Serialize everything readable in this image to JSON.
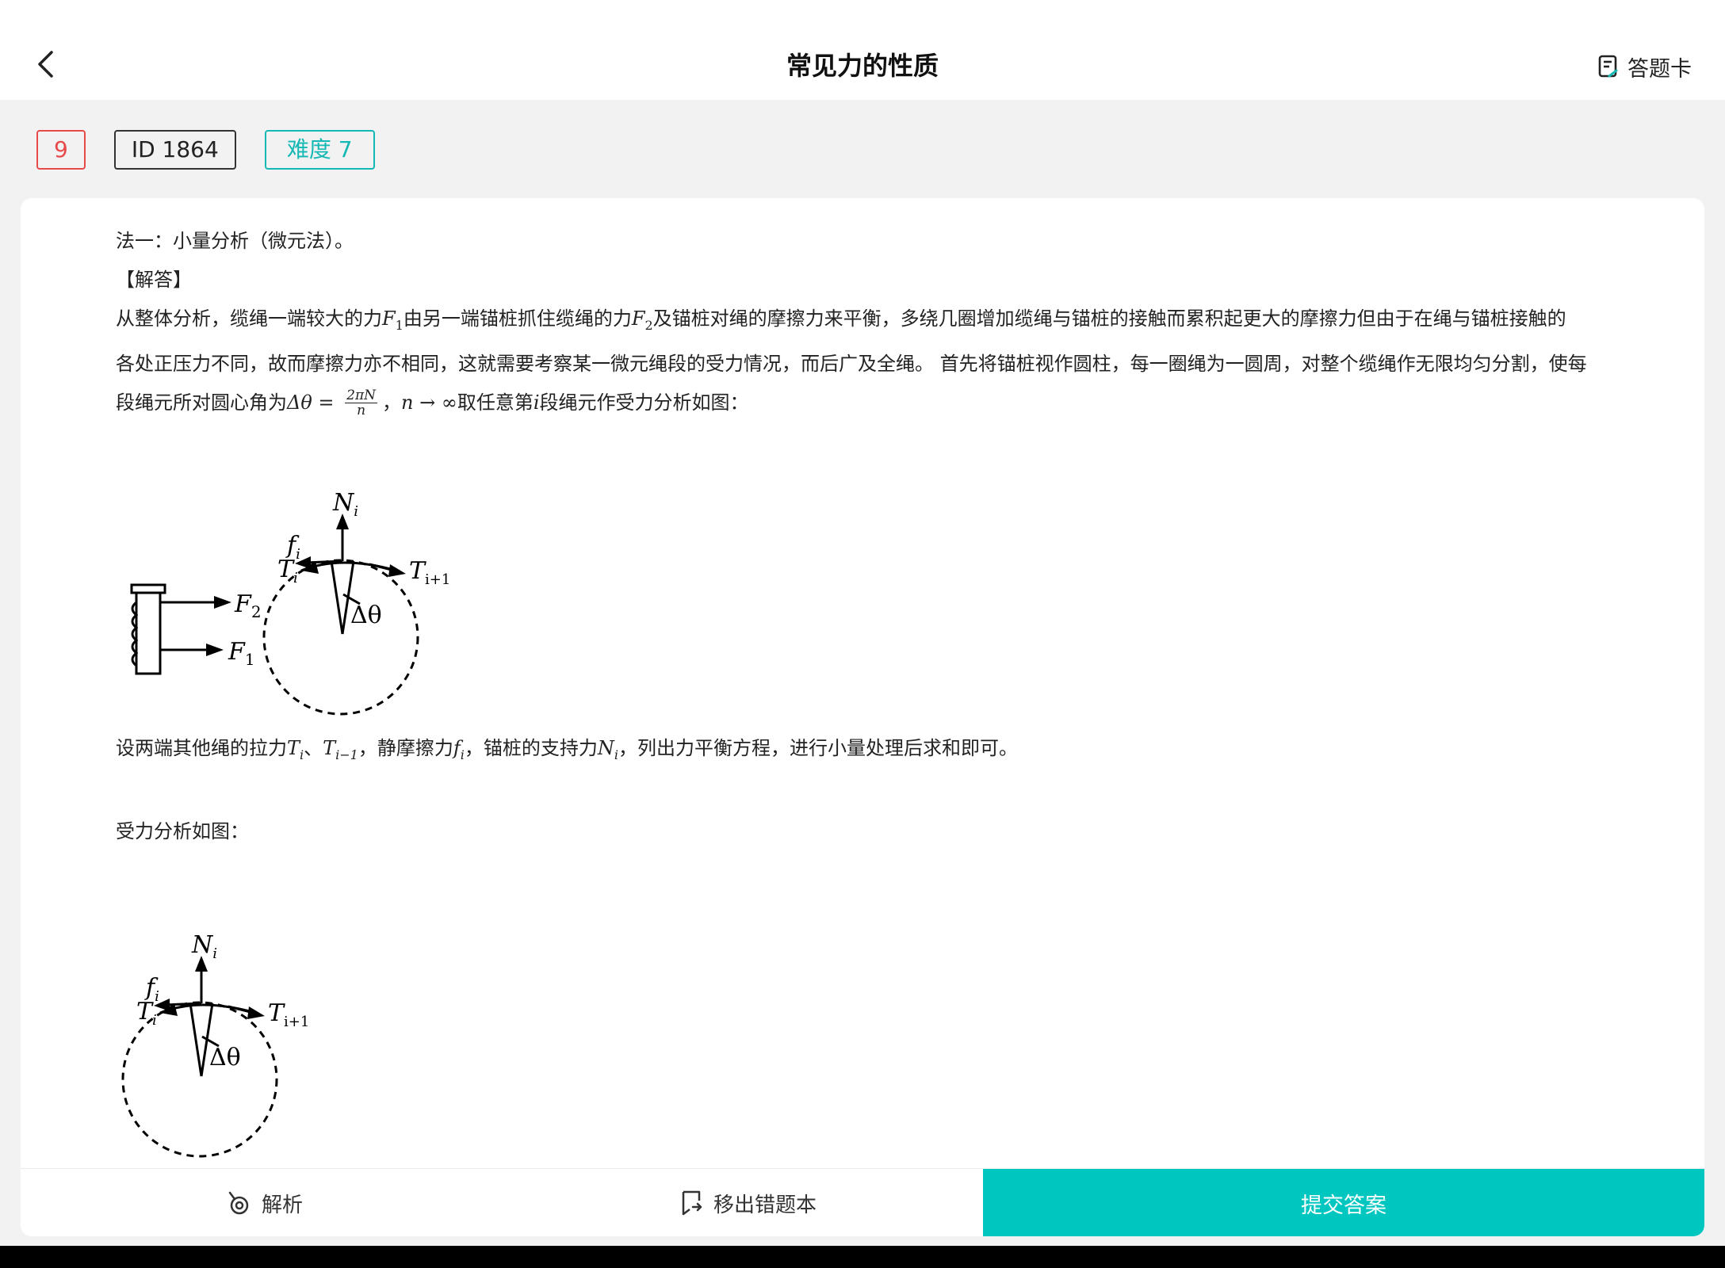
{
  "header": {
    "title": "常见力的性质",
    "answer_card_label": "答题卡"
  },
  "tags": {
    "number": "9",
    "id": "ID 1864",
    "difficulty": "难度 7"
  },
  "content": {
    "line1": "法一：小量分析（微元法）。",
    "line2": "【解答】",
    "p1_a": "从整体分析，缆绳一端较大的力",
    "p1_b": "由另一端锚桩抓住缆绳的力",
    "p1_c": "及锚桩对绳的摩擦力来平衡，多绕几圈增加缆绳与锚桩的接触而累积起更大的摩擦力但由于在绳与锚桩接触的",
    "p2": "各处正压力不同，故而摩擦力亦不相同，这就需要考察某一微元绳段的受力情况，而后广及全绳。 首先将锚桩视作圆柱，每一圈绳为一圆周，对整个缆绳作无限均匀分割，使每",
    "p3_a": "段绳元所对圆心角为",
    "p3_b": "，",
    "p3_c": "取任意第",
    "p3_d": "段绳元作受力分析如图：",
    "p4_a": "设两端其他绳的拉力",
    "p4_b": "、",
    "p4_c": "，静摩擦力",
    "p4_d": "，锚桩的支持力",
    "p4_e": "，列出力平衡方程，进行小量处理后求和即可。",
    "p5": "受力分析如图："
  },
  "math": {
    "F1": "F",
    "F1_sub": "1",
    "F2": "F",
    "F2_sub": "2",
    "delta_theta": "Δθ = ",
    "frac_num": "2πN",
    "frac_den": "n",
    "n_limit": "n → ∞",
    "i": "i",
    "Ti": "T",
    "Ti_sub": "i",
    "Ti1": "T",
    "Ti1_sub": "i−1",
    "fi": "f",
    "fi_sub": "i",
    "Ni": "N",
    "Ni_sub": "i"
  },
  "figure1": {
    "F2_label": "F",
    "F2_sub": "2",
    "F1_label": "F",
    "F1_sub": "1",
    "N_label": "N",
    "N_sub": "i",
    "f_label": "f",
    "f_sub": "i",
    "T_label": "T",
    "T_sub": "i",
    "T1_label": "T",
    "T1_sub": "i+1",
    "angle_label": "Δθ"
  },
  "figure2": {
    "N_label": "N",
    "N_sub": "i",
    "f_label": "f",
    "f_sub": "i",
    "T_label": "T",
    "T_sub": "i",
    "T1_label": "T",
    "T1_sub": "i+1",
    "angle_label": "Δθ"
  },
  "bottom_bar": {
    "analysis_label": "解析",
    "remove_label": "移出错题本",
    "submit_label": "提交答案"
  },
  "colors": {
    "accent": "#00c6c0",
    "tag_red": "#e84a4a",
    "tag_teal": "#14b9b5"
  }
}
